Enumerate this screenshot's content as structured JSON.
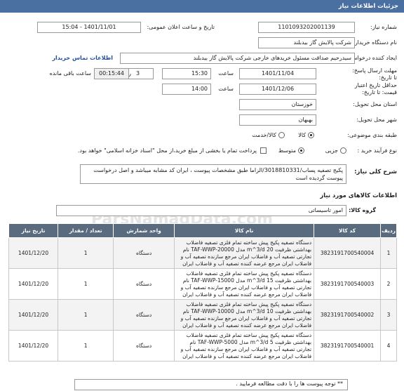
{
  "header": {
    "title": "جزئیات اطلاعات نیاز"
  },
  "form": {
    "need_number_label": "شماره نیاز:",
    "need_number": "1101093202001139",
    "announce_label": "تاریخ و ساعت اعلان عمومی:",
    "announce_value": "1401/11/01 - 15:04",
    "buyer_label": "نام دستگاه خریدار:",
    "buyer_value": "شرکت پالایش گاز بیدبلند",
    "creator_label": "ایجاد کننده درخواست:",
    "creator_value": "سیدرحیم صداقت مسئول خریدهای خارجی شرکت پالایش گاز بیدبلند",
    "contact_link": "اطلاعات تماس خریدار",
    "deadline_label": "مهلت ارسال پاسخ: تا تاریخ:",
    "deadline_date": "1401/11/04",
    "time_label": "ساعت",
    "deadline_time": "15:30",
    "days_value": "3",
    "days_label": "روز و",
    "remaining_time": "00:15:44",
    "remaining_label": "ساعت باقی مانده",
    "validity_label": "حداقل تاریخ اعتبار قیمت: تا تاریخ:",
    "validity_date": "1401/12/06",
    "validity_time": "14:00",
    "province_label": "استان محل تحویل:",
    "province_value": "خوزستان",
    "city_label": "شهر محل تحویل:",
    "city_value": "بهبهان",
    "category_label": "طبقه بندی موضوعی:",
    "category_options": [
      "کالا",
      "کالا/خدمت"
    ],
    "purchase_label": "نوع فرآیند خرید :",
    "purchase_options": [
      "جزیی",
      "متوسط"
    ],
    "purchase_note": "پرداخت تمام یا بخشی از مبلغ خرید،از محل \"اسناد خزانه اسلامی\" خواهد بود."
  },
  "summary": {
    "label": "شرح کلی نیاز:",
    "text": "پکیج تصفیه پساب/3018810331/الزاما طبق مشخصات پیوست ، ایران کد مشابه میباشد و اصل درخواست پیوست گردیده است"
  },
  "goods": {
    "title": "اطلاعات کالاهای مورد نیاز",
    "group_label": "گروه کالا:",
    "group_value": "امور تاسیساتی",
    "columns": [
      "ردیف",
      "کد کالا",
      "نام کالا",
      "واحد شمارش",
      "تعداد / مقدار",
      "تاریخ نیاز"
    ],
    "rows": [
      {
        "row": "1",
        "code": "3823191700540004",
        "name": "دستگاه تصفیه پکیج پیش ساخته تمام فلزی تصفیه فاضلاب بهداشتی ظرفیت 20 m^3/d مدل TAF-WWP-20000 نام تجارتی تصفیه آب و فاضلاب ایران مرجع سازنده تصفیه آب و فاضلاب ایران مرجع عرضه کننده تصفیه آب و فاضلاب ایران",
        "unit": "دستگاه",
        "qty": "1",
        "date": "1401/12/20"
      },
      {
        "row": "2",
        "code": "3823191700540003",
        "name": "دستگاه تصفیه پکیج پیش ساخته تمام فلزی تصفیه فاضلاب بهداشتی ظرفیت 15 m^3/d مدل TAF-WWP-15000 نام تجارتی تصفیه آب و فاضلاب ایران مرجع سازنده تصفیه آب و فاضلاب ایران مرجع عرضه کننده تصفیه آب و فاضلاب ایران",
        "unit": "دستگاه",
        "qty": "1",
        "date": "1401/12/20"
      },
      {
        "row": "3",
        "code": "3823191700540002",
        "name": "دستگاه تصفیه پکیج پیش ساخته تمام فلزی تصفیه فاضلاب بهداشتی ظرفیت 10 m^3/d مدل TAF-WWP-10000 نام تجارتی تصفیه آب و فاضلاب ایران مرجع سازنده تصفیه آب و فاضلاب ایران مرجع عرضه کننده تصفیه آب و فاضلاب ایران",
        "unit": "دستگاه",
        "qty": "1",
        "date": "1401/12/20"
      },
      {
        "row": "4",
        "code": "3823191700540001",
        "name": "دستگاه تصفیه پکیج پیش ساخته تمام فلزی تصفیه فاضلاب بهداشتی ظرفیت 5 m^3/d مدل TAF-WWP-5000 نام تجارتی تصفیه آب و فاضلاب ایران مرجع سازنده تصفیه آب و فاضلاب ایران مرجع عرضه کننده تصفیه آب و فاضلاب ایران",
        "unit": "دستگاه",
        "qty": "1",
        "date": "1401/12/20"
      }
    ]
  },
  "footer_note": "** توجه پیوست ها  را با دقت مطالعه فرمایید .",
  "watermark": "ParsNamadData.com"
}
